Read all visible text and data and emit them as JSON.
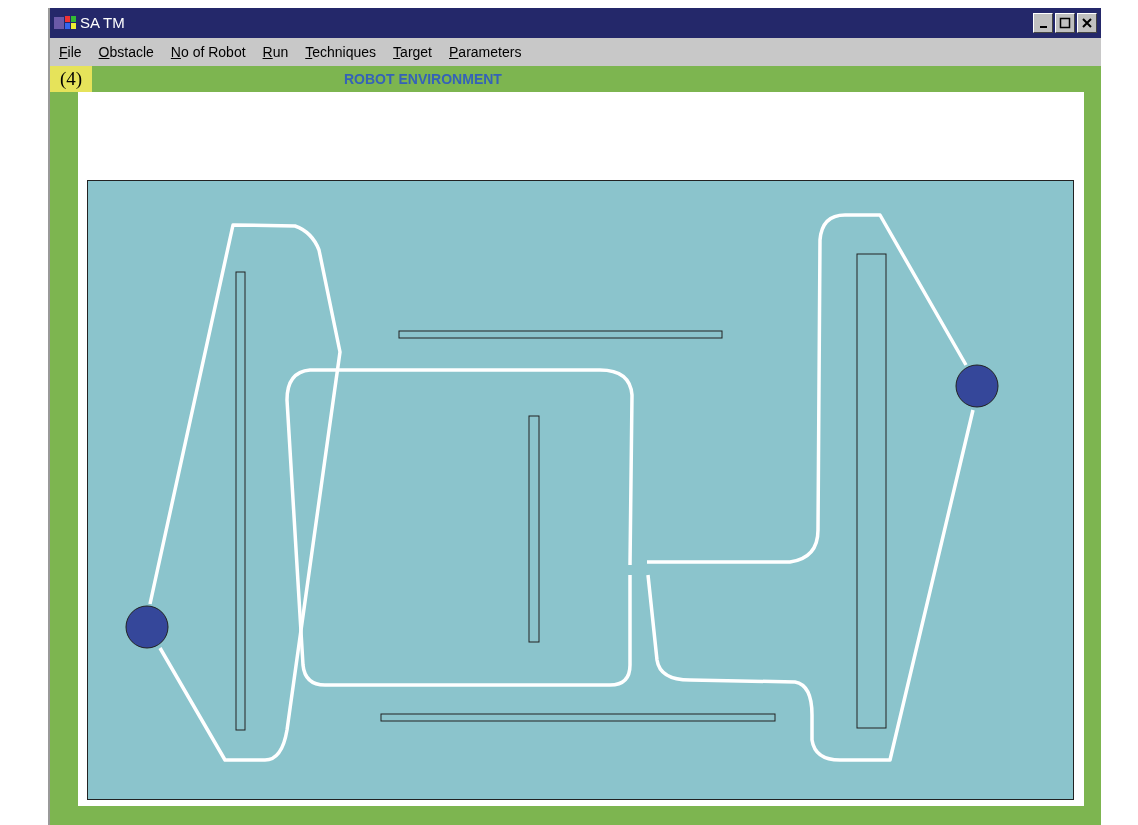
{
  "window": {
    "title": "SA TM"
  },
  "menu": [
    {
      "label": "File"
    },
    {
      "label": "Obstacle"
    },
    {
      "label": "No of Robot"
    },
    {
      "label": "Run"
    },
    {
      "label": "Techniques"
    },
    {
      "label": "Target"
    },
    {
      "label": "Parameters"
    }
  ],
  "panel": {
    "badge": "(4)",
    "title": "ROBOT ENVIRONMENT"
  }
}
